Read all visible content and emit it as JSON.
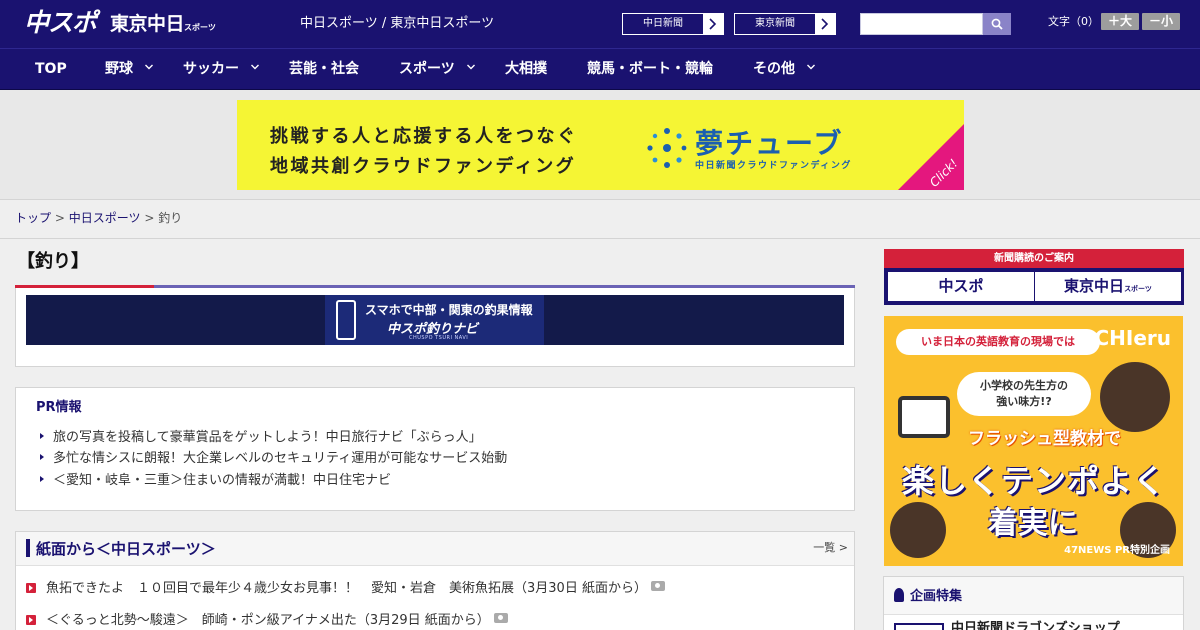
{
  "header": {
    "logo_main": "中スポ",
    "logo_sub": "東京中日",
    "logo_sub_small": "スポーツ",
    "site_names": "中日スポーツ / 東京中日スポーツ",
    "paper_links": [
      {
        "label": "中日新聞"
      },
      {
        "label": "東京新聞"
      }
    ],
    "search": {
      "value": "",
      "placeholder": ""
    },
    "font_size_label": "文字（0）",
    "font_larger": "＋大",
    "font_smaller": "－小"
  },
  "nav": [
    {
      "label": "TOP",
      "has_dropdown": false
    },
    {
      "label": "野球",
      "has_dropdown": true
    },
    {
      "label": "サッカー",
      "has_dropdown": true
    },
    {
      "label": "芸能・社会",
      "has_dropdown": false
    },
    {
      "label": "スポーツ",
      "has_dropdown": true
    },
    {
      "label": "大相撲",
      "has_dropdown": false
    },
    {
      "label": "競馬・ボート・競輪",
      "has_dropdown": false
    },
    {
      "label": "その他",
      "has_dropdown": true
    }
  ],
  "banner": {
    "line1": "挑戦する人と応援する人をつなぐ",
    "line2": "地域共創クラウドファンディング",
    "brand": "夢チューブ",
    "brand_sub": "中日新聞クラウドファンディング",
    "corner": "Click!"
  },
  "breadcrumb": {
    "items": [
      "トップ",
      "中日スポーツ"
    ],
    "separator": ">",
    "current": "釣り"
  },
  "category": {
    "title": "【釣り】"
  },
  "fishing_banner": {
    "line1": "スマホで中部・関東の釣果情報",
    "line2": "中スポ釣りナビ",
    "line3": "CHUSPO TSURI NAVI"
  },
  "pr": {
    "title": "PR情報",
    "items": [
      "旅の写真を投稿して豪華賞品をゲットしよう！中日旅行ナビ「ぶらっ人」",
      "多忙な情シスに朗報！大企業レベルのセキュリティ運用が可能なサービス始動",
      "＜愛知・岐阜・三重＞住まいの情報が満載！中日住宅ナビ"
    ]
  },
  "paper_section": {
    "title": "紙面から＜中日スポーツ＞",
    "more": "一覧 >",
    "items": [
      "魚拓できたよ　１０回目で最年少４歳少女お見事！！　愛知・岩倉　美術魚拓展（3月30日 紙面から）",
      "＜ぐるっと北勢～駿遠＞　師崎・ポン級アイナメ出た（3月29日 紙面から）"
    ]
  },
  "sidebar": {
    "subscribe_head": "新聞購読のご案内",
    "subscribe_btns": [
      {
        "label": "中スポ",
        "small": ""
      },
      {
        "label": "東京中日",
        "small": "スポーツ"
      }
    ],
    "ad": {
      "top": "いま日本の英語教育の現場では",
      "logo": "CHIeru",
      "question_l1": "小学校の先生方の",
      "question_l2": "強い味方!?",
      "flash": "フラッシュ型教材で",
      "big1": "楽しくテンポよく",
      "big2": "着実に",
      "foot": "47NEWS PR特別企画"
    },
    "feature": {
      "title": "企画特集",
      "first_item": "中日新聞ドラゴンズショップ"
    }
  },
  "colors": {
    "brand_navy": "#1a1270",
    "accent_red": "#d4213a",
    "banner_yellow": "#f5f534",
    "ad_orange": "#fbc02d"
  }
}
